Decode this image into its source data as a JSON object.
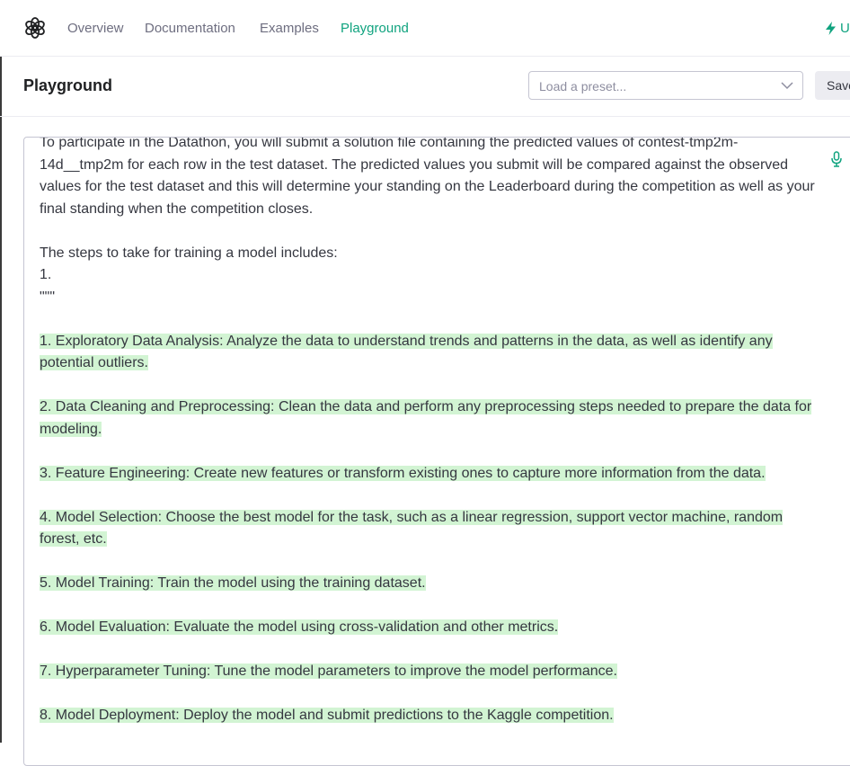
{
  "nav": {
    "links": [
      "Overview",
      "Documentation",
      "Examples",
      "Playground"
    ],
    "active": "Playground",
    "upgrade_label": "U"
  },
  "header": {
    "title": "Playground",
    "preset_placeholder": "Load a preset...",
    "save_label": "Save"
  },
  "editor": {
    "prompt_lines": [
      "To participate in the Datathon, you will submit a solution file containing the predicted values of contest-tmp2m-14d__tmp2m for each row in the test dataset. The predicted values you submit will be compared against the observed values for the test dataset and this will determine your standing on the Leaderboard during the competition as well as your final standing when the competition closes.",
      "",
      "The steps to take for training a model includes:",
      "1.",
      "\"\"\""
    ],
    "completion_lines": [
      "1. Exploratory Data Analysis: Analyze the data to understand trends and patterns in the data, as well as identify any potential outliers.",
      "2. Data Cleaning and Preprocessing: Clean the data and perform any preprocessing steps needed to prepare the data for modeling.",
      "3. Feature Engineering: Create new features or transform existing ones to capture more information from the data.",
      "4. Model Selection: Choose the best model for the task, such as a linear regression, support vector machine, random forest, etc.",
      "5. Model Training: Train the model using the training dataset.",
      "6. Model Evaluation: Evaluate the model using cross-validation and other metrics.",
      "7. Hyperparameter Tuning: Tune the model parameters to improve the model performance.",
      "8. Model Deployment: Deploy the model and submit predictions to the Kaggle competition."
    ]
  },
  "colors": {
    "accent": "#10a37f",
    "completion_highlight": "#d2f4d3",
    "text": "#353740"
  },
  "icons": [
    "openai-logo-icon",
    "lightning-icon",
    "chevron-down-icon",
    "microphone-icon"
  ]
}
